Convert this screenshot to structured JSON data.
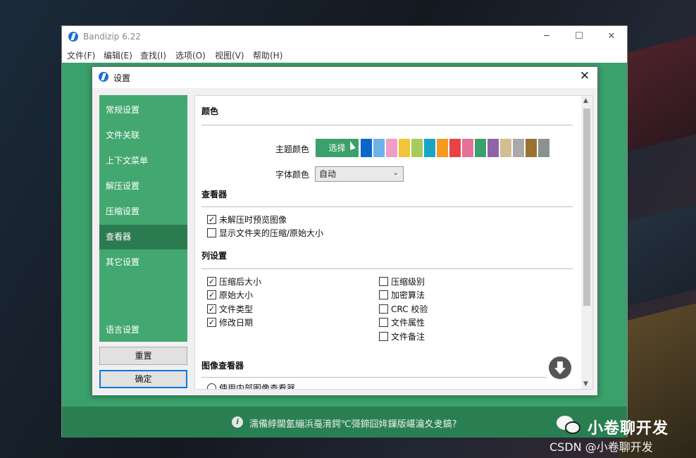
{
  "app": {
    "title": "Bandizip 6.22",
    "window_controls": {
      "minimize": "─",
      "maximize": "☐",
      "close": "✕"
    },
    "menu": [
      "文件(F)",
      "编辑(E)",
      "查找(I)",
      "选项(O)",
      "视图(V)",
      "帮助(H)"
    ],
    "info_text": "濡備綍閫氳繃浜戞湇鍔℃彁鍗囧姩鏁版嵁瀹夊叏鎬?"
  },
  "dialog": {
    "title": "设置",
    "close": "✕",
    "sidebar": [
      {
        "label": "常规设置",
        "active": false
      },
      {
        "label": "文件关联",
        "active": false
      },
      {
        "label": "上下文菜单",
        "active": false
      },
      {
        "label": "解压设置",
        "active": false
      },
      {
        "label": "压缩设置",
        "active": false
      },
      {
        "label": "查看器",
        "active": true
      },
      {
        "label": "其它设置",
        "active": false
      },
      {
        "label": "语言设置",
        "active": false
      }
    ],
    "buttons": {
      "reset": "重置",
      "ok": "确定"
    },
    "color_section": {
      "heading": "颜色",
      "theme_label": "主题颜色",
      "select_label": "选择",
      "swatches": [
        "#0a66c9",
        "#6db3e8",
        "#f19dc8",
        "#f2c53a",
        "#a7cb5b",
        "#1aa4c4",
        "#f39a21",
        "#e84242",
        "#e67097",
        "#3aa06c",
        "#8e64a5",
        "#d3bd92",
        "#a9a9a9",
        "#9a7232",
        "#8a9191"
      ],
      "font_label": "字体颜色",
      "font_value": "自动"
    },
    "viewer_section": {
      "heading": "查看器",
      "options": [
        {
          "label": "未解压时预览图像",
          "checked": true
        },
        {
          "label": "显示文件夹的压缩/原始大小",
          "checked": false
        }
      ]
    },
    "columns_section": {
      "heading": "列设置",
      "left": [
        {
          "label": "压缩后大小",
          "checked": true
        },
        {
          "label": "原始大小",
          "checked": true
        },
        {
          "label": "文件类型",
          "checked": true
        },
        {
          "label": "修改日期",
          "checked": true
        }
      ],
      "right": [
        {
          "label": "压缩级别",
          "checked": false
        },
        {
          "label": "加密算法",
          "checked": false
        },
        {
          "label": "CRC 校验",
          "checked": false
        },
        {
          "label": "文件属性",
          "checked": false
        },
        {
          "label": "文件备注",
          "checked": false
        }
      ]
    },
    "image_viewer_section": {
      "heading": "图像查看器",
      "partial_option": "使用内部图像查看器"
    }
  },
  "watermark": {
    "name": "小卷聊开发",
    "csdn": "CSDN @小卷聊开发"
  }
}
